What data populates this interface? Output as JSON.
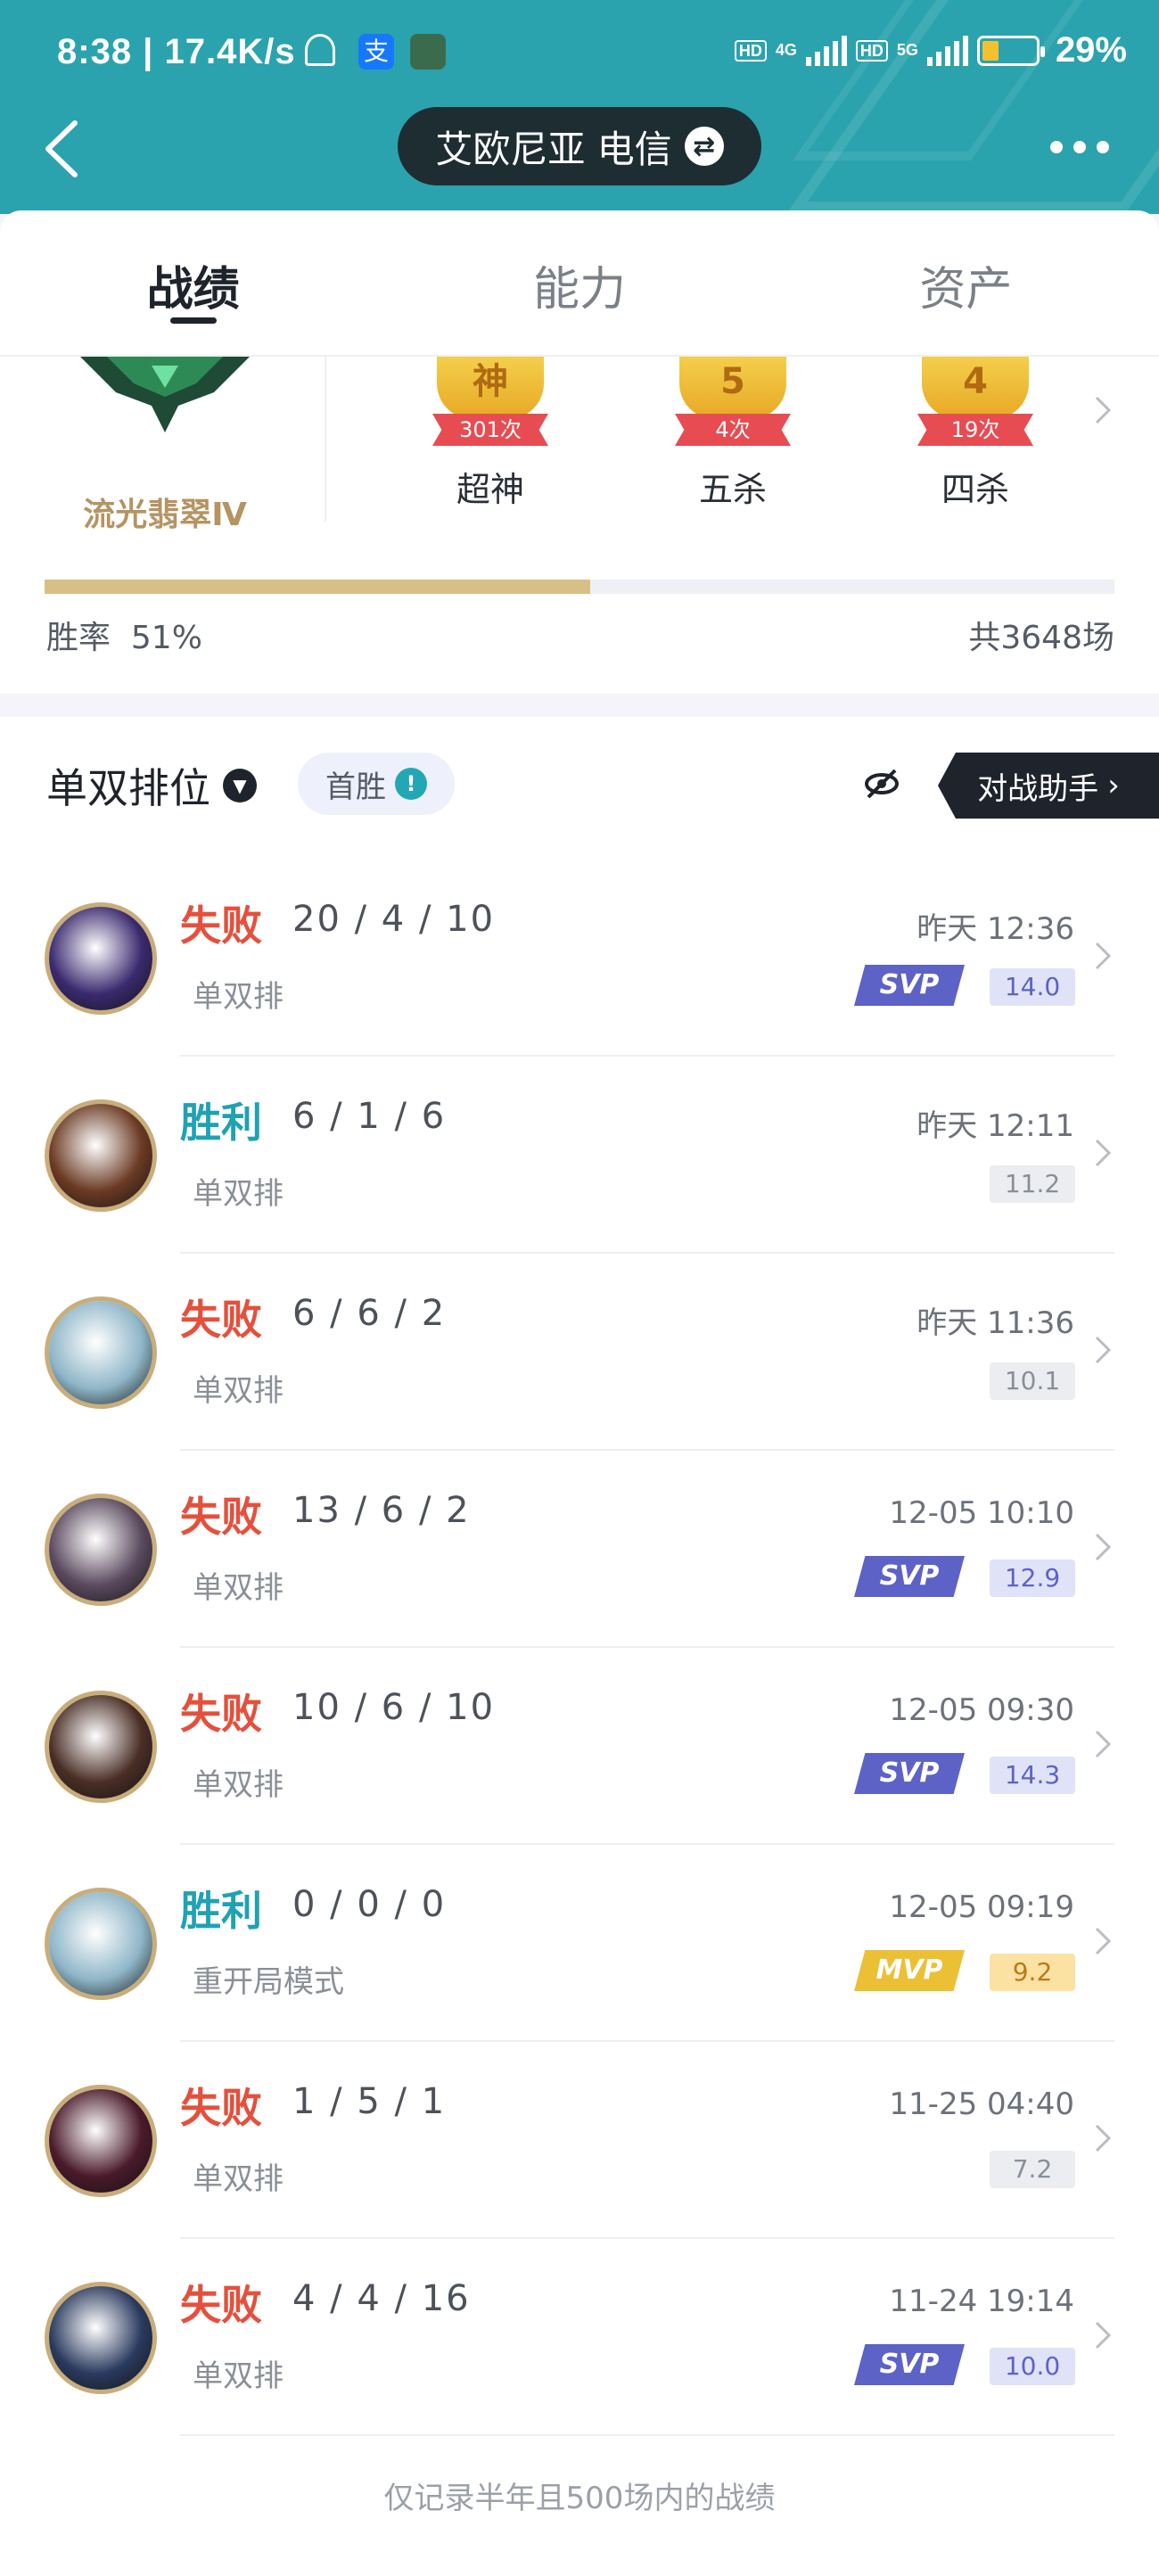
{
  "status_bar": {
    "time": "8:38",
    "speed": "17.4K/s",
    "net1": "4G",
    "net2": "5G",
    "hd": "HD",
    "battery": "29%"
  },
  "header": {
    "server": "艾欧尼亚 电信",
    "swap_symbol": "⇄"
  },
  "tabs": [
    {
      "label": "战绩",
      "active": true
    },
    {
      "label": "能力",
      "active": false
    },
    {
      "label": "资产",
      "active": false
    }
  ],
  "summary": {
    "rank": "流光翡翠Ⅳ",
    "medals": [
      {
        "icon": "神",
        "count": "301次",
        "label": "超神"
      },
      {
        "icon": "5",
        "count": "4次",
        "label": "五杀"
      },
      {
        "icon": "4",
        "count": "19次",
        "label": "四杀"
      }
    ],
    "win_rate_label": "胜率",
    "win_rate": "51%",
    "win_rate_value": 0.51,
    "total": "共3648场"
  },
  "filter": {
    "mode": "单双排位",
    "first_win": "首胜",
    "first_win_icon": "!",
    "helper": "对战助手"
  },
  "colors": {
    "header": "#2aa3ae",
    "lose": "#e5503c",
    "win": "#1fa2b2",
    "svp": "#5d62c7",
    "mvp": "#ebc034",
    "rank_gold": "#b49462"
  },
  "matches": [
    {
      "result": "失败",
      "outcome": "lose",
      "kda": "20 / 4 / 10",
      "queue": "单双排",
      "time": "昨天 12:36",
      "badge": "SVP",
      "score": "14.0",
      "avatar": "#3a2a6e"
    },
    {
      "result": "胜利",
      "outcome": "win",
      "kda": "6 / 1 / 6",
      "queue": "单双排",
      "time": "昨天 12:11",
      "badge": "",
      "score": "11.2",
      "avatar": "#6b3a24"
    },
    {
      "result": "失败",
      "outcome": "lose",
      "kda": "6 / 6 / 2",
      "queue": "单双排",
      "time": "昨天 11:36",
      "badge": "",
      "score": "10.1",
      "avatar": "#8fb6c8"
    },
    {
      "result": "失败",
      "outcome": "lose",
      "kda": "13 / 6 / 2",
      "queue": "单双排",
      "time": "12-05 10:10",
      "badge": "SVP",
      "score": "12.9",
      "avatar": "#5a4a5e"
    },
    {
      "result": "失败",
      "outcome": "lose",
      "kda": "10 / 6 / 10",
      "queue": "单双排",
      "time": "12-05 09:30",
      "badge": "SVP",
      "score": "14.3",
      "avatar": "#4a2e26"
    },
    {
      "result": "胜利",
      "outcome": "win",
      "kda": "0 / 0 / 0",
      "queue": "重开局模式",
      "time": "12-05 09:19",
      "badge": "MVP",
      "score": "9.2",
      "avatar": "#8fb6c8"
    },
    {
      "result": "失败",
      "outcome": "lose",
      "kda": "1 / 5 / 1",
      "queue": "单双排",
      "time": "11-25 04:40",
      "badge": "",
      "score": "7.2",
      "avatar": "#4a1a2a"
    },
    {
      "result": "失败",
      "outcome": "lose",
      "kda": "4 / 4 / 16",
      "queue": "单双排",
      "time": "11-24 19:14",
      "badge": "SVP",
      "score": "10.0",
      "avatar": "#2a3a5e"
    }
  ],
  "footnote": "仅记录半年且500场内的战绩"
}
